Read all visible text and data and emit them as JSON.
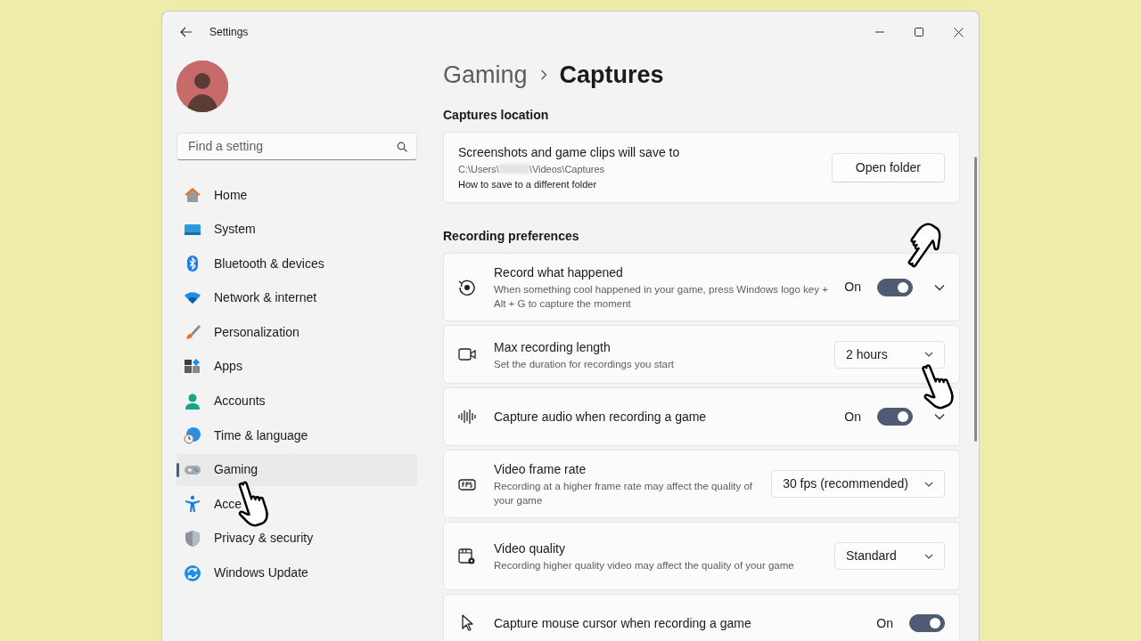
{
  "window": {
    "title": "Settings"
  },
  "sidebar": {
    "search": {
      "placeholder": "Find a setting"
    },
    "items": [
      {
        "label": "Home",
        "selected": false
      },
      {
        "label": "System",
        "selected": false
      },
      {
        "label": "Bluetooth & devices",
        "selected": false
      },
      {
        "label": "Network & internet",
        "selected": false
      },
      {
        "label": "Personalization",
        "selected": false
      },
      {
        "label": "Apps",
        "selected": false
      },
      {
        "label": "Accounts",
        "selected": false
      },
      {
        "label": "Time & language",
        "selected": false
      },
      {
        "label": "Gaming",
        "selected": true
      },
      {
        "label": "Acce",
        "selected": false
      },
      {
        "label": "Privacy & security",
        "selected": false
      },
      {
        "label": "Windows Update",
        "selected": false
      }
    ]
  },
  "breadcrumb": {
    "parent": "Gaming",
    "current": "Captures"
  },
  "captures_location": {
    "heading": "Captures location",
    "title": "Screenshots and game clips will save to",
    "path_start": "C:\\Users\\",
    "path_end": "\\Videos\\Captures",
    "link": "How to save to a different folder",
    "button": "Open folder"
  },
  "recording_preferences": {
    "heading": "Recording preferences",
    "rows": [
      {
        "kind": "toggle",
        "title": "Record what happened",
        "description": "When something cool happened in your game, press Windows logo key + Alt + G to capture the moment",
        "state_label": "On",
        "on": true,
        "expandable": true
      },
      {
        "kind": "dropdown",
        "title": "Max recording length",
        "description": "Set the duration for recordings you start",
        "value": "2 hours"
      },
      {
        "kind": "toggle",
        "title": "Capture audio when recording a game",
        "state_label": "On",
        "on": true,
        "expandable": true
      },
      {
        "kind": "dropdown",
        "title": "Video frame rate",
        "description": "Recording at a higher frame rate may affect the quality of your game",
        "value": "30 fps (recommended)"
      },
      {
        "kind": "dropdown",
        "title": "Video quality",
        "description": "Recording higher quality video may affect the quality of your game",
        "value": "Standard"
      },
      {
        "kind": "toggle",
        "title": "Capture mouse cursor when recording a game",
        "state_label": "On",
        "on": true,
        "expandable": false
      }
    ]
  }
}
